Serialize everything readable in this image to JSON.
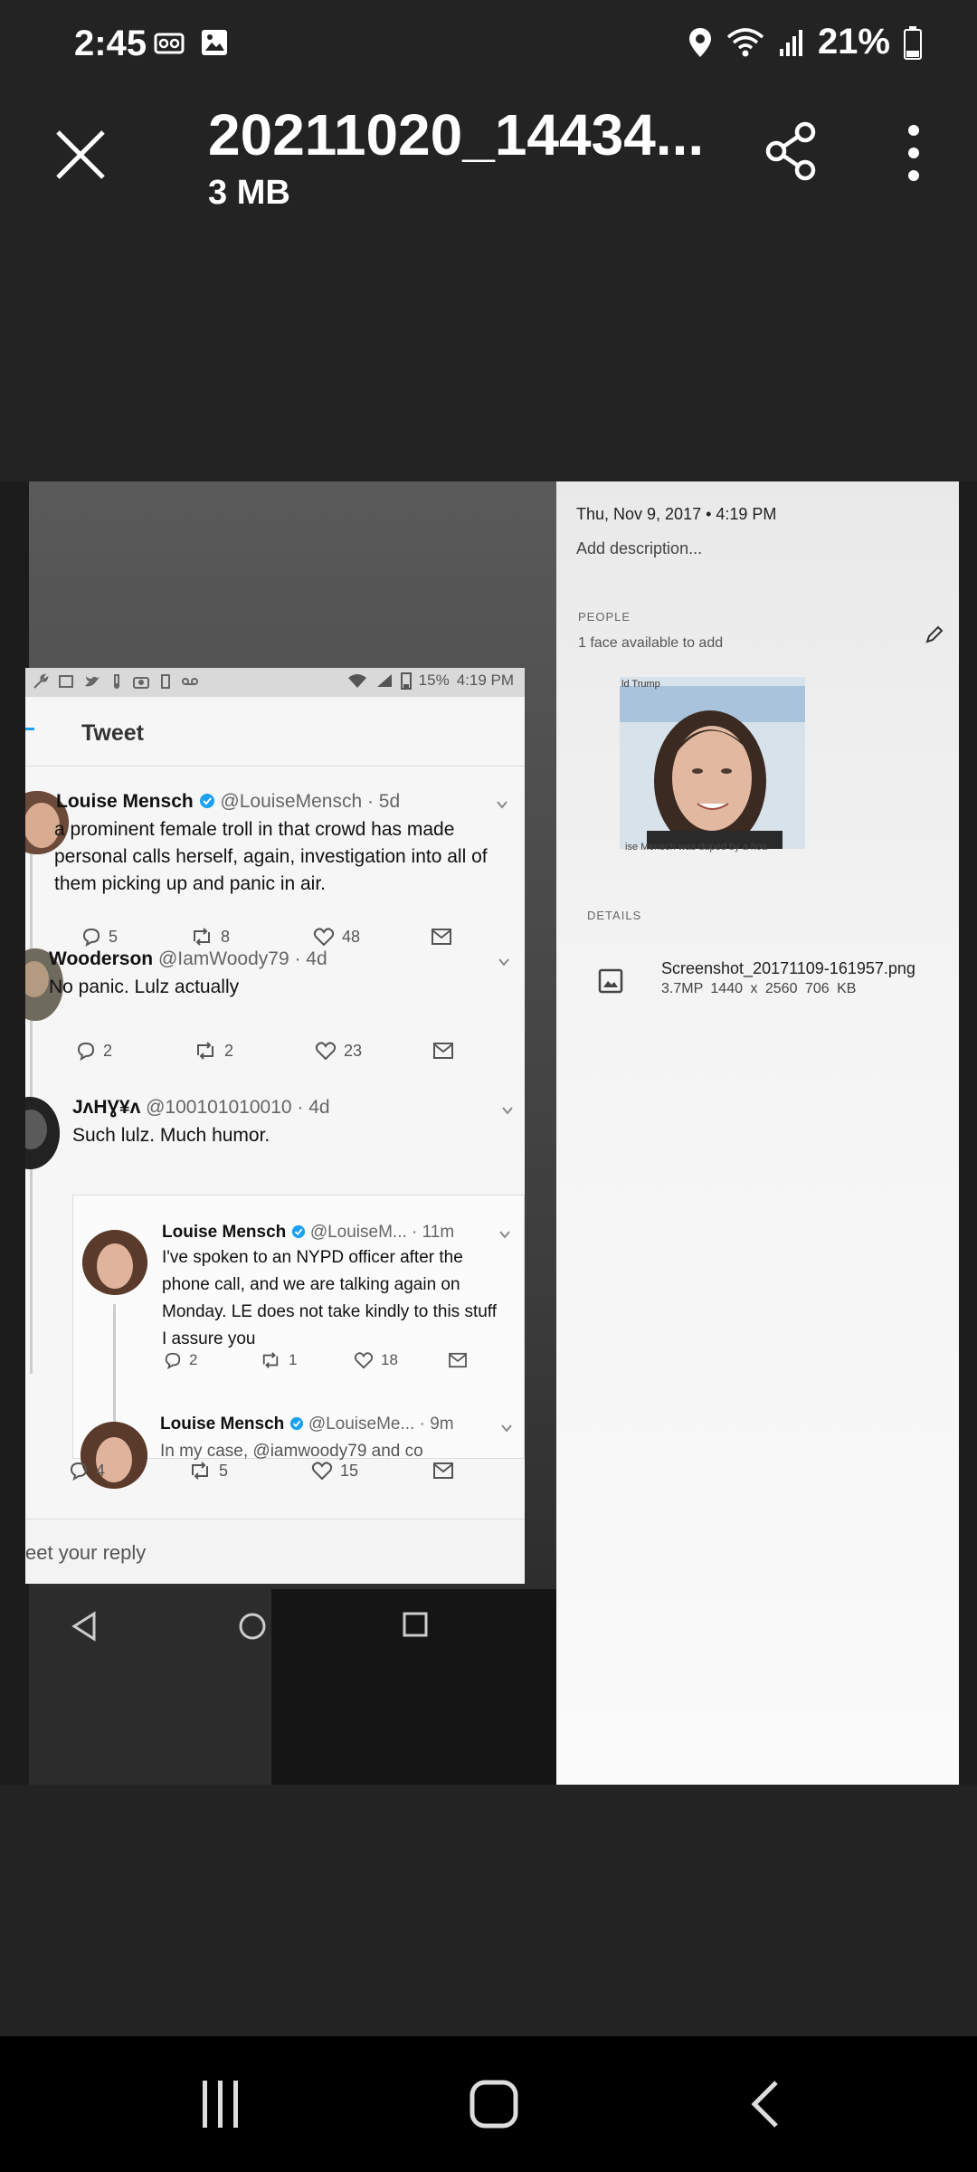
{
  "status_bar": {
    "time": "2:45",
    "battery": "21%",
    "left_icons": [
      "voicemail-icon",
      "image-icon"
    ],
    "right_icons": [
      "location-icon",
      "wifi-icon",
      "signal-icon",
      "battery-icon"
    ]
  },
  "app_bar": {
    "title": "20211020_14434...",
    "subtitle": "3 MB"
  },
  "photo": {
    "right_panel": {
      "date": "Thu, Nov 9, 2017  •  4:19 PM",
      "add_description": "Add description...",
      "people_heading": "PEOPLE",
      "face_note": "1 face available to add",
      "face_caption_top": "ld Trump",
      "face_caption_bottom": "ise Mensch was duped by a hoa",
      "details_heading": "DETAILS",
      "file_name": "Screenshot_20171109-161957.png",
      "file_meta": "3.7MP   1440 x 2560   706 KB"
    },
    "tweet_screen": {
      "status_battery": "15%",
      "status_time": "4:19 PM",
      "header_title": "Tweet",
      "tweets": [
        {
          "name": "Louise Mensch",
          "handle": "@LouiseMensch · 5d",
          "text": "a prominent female troll in that crowd has made personal calls herself, again, investigation into all of them picking up and panic in air.",
          "replies": "5",
          "retweets": "8",
          "likes": "48"
        },
        {
          "name": "Wooderson",
          "handle": "@IamWoody79 · 4d",
          "text": "No panic.  Lulz actually",
          "replies": "2",
          "retweets": "2",
          "likes": "23"
        },
        {
          "name": "JᴧHƔ¥ᴧ",
          "handle": "@100101010010 · 4d",
          "text": "Such lulz. Much humor.",
          "replies": "4",
          "retweets": "5",
          "likes": "15"
        }
      ],
      "quoted": [
        {
          "name": "Louise Mensch",
          "handle": "@LouiseM... · 11m",
          "text": "I've spoken to an NYPD officer after the phone call, and we are talking again on Monday. LE does not take kindly to this stuff I assure you",
          "replies": "2",
          "retweets": "1",
          "likes": "18"
        },
        {
          "name": "Louise Mensch",
          "handle": "@LouiseMe... · 9m",
          "text": "In my case, @iamwoody79 and co"
        }
      ],
      "reply_placeholder": "eet your reply"
    }
  },
  "nav_bar": {
    "buttons": [
      "recents-icon",
      "home-icon",
      "back-icon"
    ]
  },
  "colors": {
    "background": "#232323",
    "twitter_blue": "#1da1f2"
  }
}
